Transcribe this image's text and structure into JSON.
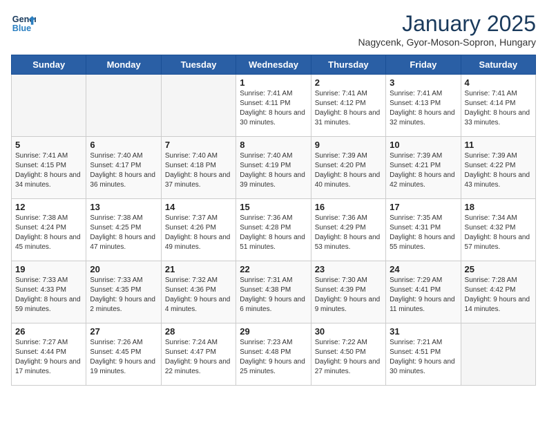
{
  "logo": {
    "line1": "General",
    "line2": "Blue"
  },
  "title": "January 2025",
  "subtitle": "Nagycenk, Gyor-Moson-Sopron, Hungary",
  "headers": [
    "Sunday",
    "Monday",
    "Tuesday",
    "Wednesday",
    "Thursday",
    "Friday",
    "Saturday"
  ],
  "weeks": [
    [
      {
        "day": "",
        "info": ""
      },
      {
        "day": "",
        "info": ""
      },
      {
        "day": "",
        "info": ""
      },
      {
        "day": "1",
        "info": "Sunrise: 7:41 AM\nSunset: 4:11 PM\nDaylight: 8 hours\nand 30 minutes."
      },
      {
        "day": "2",
        "info": "Sunrise: 7:41 AM\nSunset: 4:12 PM\nDaylight: 8 hours\nand 31 minutes."
      },
      {
        "day": "3",
        "info": "Sunrise: 7:41 AM\nSunset: 4:13 PM\nDaylight: 8 hours\nand 32 minutes."
      },
      {
        "day": "4",
        "info": "Sunrise: 7:41 AM\nSunset: 4:14 PM\nDaylight: 8 hours\nand 33 minutes."
      }
    ],
    [
      {
        "day": "5",
        "info": "Sunrise: 7:41 AM\nSunset: 4:15 PM\nDaylight: 8 hours\nand 34 minutes."
      },
      {
        "day": "6",
        "info": "Sunrise: 7:40 AM\nSunset: 4:17 PM\nDaylight: 8 hours\nand 36 minutes."
      },
      {
        "day": "7",
        "info": "Sunrise: 7:40 AM\nSunset: 4:18 PM\nDaylight: 8 hours\nand 37 minutes."
      },
      {
        "day": "8",
        "info": "Sunrise: 7:40 AM\nSunset: 4:19 PM\nDaylight: 8 hours\nand 39 minutes."
      },
      {
        "day": "9",
        "info": "Sunrise: 7:39 AM\nSunset: 4:20 PM\nDaylight: 8 hours\nand 40 minutes."
      },
      {
        "day": "10",
        "info": "Sunrise: 7:39 AM\nSunset: 4:21 PM\nDaylight: 8 hours\nand 42 minutes."
      },
      {
        "day": "11",
        "info": "Sunrise: 7:39 AM\nSunset: 4:22 PM\nDaylight: 8 hours\nand 43 minutes."
      }
    ],
    [
      {
        "day": "12",
        "info": "Sunrise: 7:38 AM\nSunset: 4:24 PM\nDaylight: 8 hours\nand 45 minutes."
      },
      {
        "day": "13",
        "info": "Sunrise: 7:38 AM\nSunset: 4:25 PM\nDaylight: 8 hours\nand 47 minutes."
      },
      {
        "day": "14",
        "info": "Sunrise: 7:37 AM\nSunset: 4:26 PM\nDaylight: 8 hours\nand 49 minutes."
      },
      {
        "day": "15",
        "info": "Sunrise: 7:36 AM\nSunset: 4:28 PM\nDaylight: 8 hours\nand 51 minutes."
      },
      {
        "day": "16",
        "info": "Sunrise: 7:36 AM\nSunset: 4:29 PM\nDaylight: 8 hours\nand 53 minutes."
      },
      {
        "day": "17",
        "info": "Sunrise: 7:35 AM\nSunset: 4:31 PM\nDaylight: 8 hours\nand 55 minutes."
      },
      {
        "day": "18",
        "info": "Sunrise: 7:34 AM\nSunset: 4:32 PM\nDaylight: 8 hours\nand 57 minutes."
      }
    ],
    [
      {
        "day": "19",
        "info": "Sunrise: 7:33 AM\nSunset: 4:33 PM\nDaylight: 8 hours\nand 59 minutes."
      },
      {
        "day": "20",
        "info": "Sunrise: 7:33 AM\nSunset: 4:35 PM\nDaylight: 9 hours\nand 2 minutes."
      },
      {
        "day": "21",
        "info": "Sunrise: 7:32 AM\nSunset: 4:36 PM\nDaylight: 9 hours\nand 4 minutes."
      },
      {
        "day": "22",
        "info": "Sunrise: 7:31 AM\nSunset: 4:38 PM\nDaylight: 9 hours\nand 6 minutes."
      },
      {
        "day": "23",
        "info": "Sunrise: 7:30 AM\nSunset: 4:39 PM\nDaylight: 9 hours\nand 9 minutes."
      },
      {
        "day": "24",
        "info": "Sunrise: 7:29 AM\nSunset: 4:41 PM\nDaylight: 9 hours\nand 11 minutes."
      },
      {
        "day": "25",
        "info": "Sunrise: 7:28 AM\nSunset: 4:42 PM\nDaylight: 9 hours\nand 14 minutes."
      }
    ],
    [
      {
        "day": "26",
        "info": "Sunrise: 7:27 AM\nSunset: 4:44 PM\nDaylight: 9 hours\nand 17 minutes."
      },
      {
        "day": "27",
        "info": "Sunrise: 7:26 AM\nSunset: 4:45 PM\nDaylight: 9 hours\nand 19 minutes."
      },
      {
        "day": "28",
        "info": "Sunrise: 7:24 AM\nSunset: 4:47 PM\nDaylight: 9 hours\nand 22 minutes."
      },
      {
        "day": "29",
        "info": "Sunrise: 7:23 AM\nSunset: 4:48 PM\nDaylight: 9 hours\nand 25 minutes."
      },
      {
        "day": "30",
        "info": "Sunrise: 7:22 AM\nSunset: 4:50 PM\nDaylight: 9 hours\nand 27 minutes."
      },
      {
        "day": "31",
        "info": "Sunrise: 7:21 AM\nSunset: 4:51 PM\nDaylight: 9 hours\nand 30 minutes."
      },
      {
        "day": "",
        "info": ""
      }
    ]
  ]
}
